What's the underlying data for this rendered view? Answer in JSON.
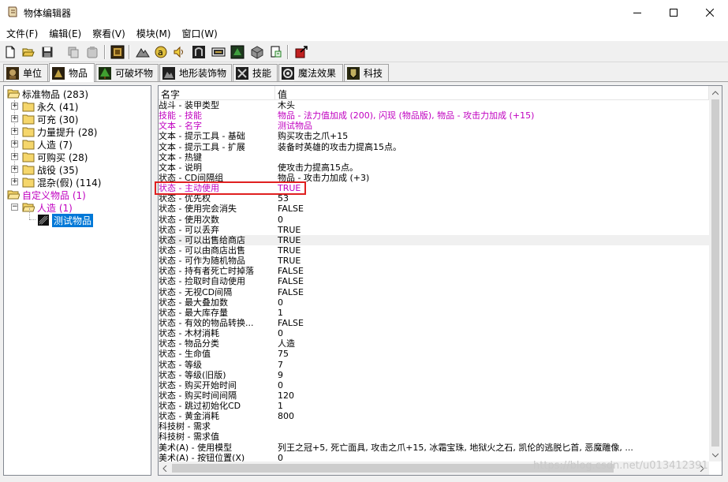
{
  "window": {
    "title": "物体编辑器",
    "icons": {
      "app": "scroll-icon",
      "minimize": "minimize-icon",
      "maximize": "maximize-icon",
      "close": "close-icon"
    }
  },
  "menu": [
    "文件(F)",
    "编辑(E)",
    "察看(V)",
    "模块(M)",
    "窗口(W)"
  ],
  "toolbar": [
    "new-file-icon",
    "open-folder-icon",
    "save-icon",
    "copy-icon",
    "paste-icon",
    "unit-editor-icon",
    "terrain-icon",
    "sound-icon",
    "volume-icon",
    "object-icon",
    "doodad-icon",
    "item-icon",
    "ability-icon",
    "upgrade-icon",
    "import-icon",
    "test-map-icon"
  ],
  "tabs": [
    {
      "label": "单位",
      "icon": "unit-tab-icon"
    },
    {
      "label": "物品",
      "icon": "item-tab-icon"
    },
    {
      "label": "可破坏物",
      "icon": "destructible-tab-icon"
    },
    {
      "label": "地形装饰物",
      "icon": "doodad-tab-icon"
    },
    {
      "label": "技能",
      "icon": "ability-tab-icon"
    },
    {
      "label": "魔法效果",
      "icon": "buff-tab-icon"
    },
    {
      "label": "科技",
      "icon": "upgrade-tab-icon"
    }
  ],
  "tree": {
    "standard": {
      "label": "标准物品 (283)",
      "children": [
        "永久 (41)",
        "可充 (30)",
        "力量提升 (28)",
        "人造 (7)",
        "可购买 (28)",
        "战役 (35)",
        "混杂(假) (114)"
      ]
    },
    "custom": {
      "label": "自定义物品 (1)",
      "child": "人造 (1)",
      "leaf": "测试物品"
    }
  },
  "list": {
    "columns": [
      "名字",
      "值"
    ],
    "rows": [
      {
        "name": "战斗 - 装甲类型",
        "value": "木头"
      },
      {
        "name": "技能 - 技能",
        "value": "物品 - 法力值加成 (200), 闪现 (物品版), 物品 - 攻击力加成 (+15)",
        "pink": true
      },
      {
        "name": "文本 - 名字",
        "value": "测试物品",
        "pink": true
      },
      {
        "name": "文本 - 提示工具 - 基础",
        "value": "购买攻击之爪+15"
      },
      {
        "name": "文本 - 提示工具 - 扩展",
        "value": "装备时英雄的攻击力提高15点。"
      },
      {
        "name": "文本 - 热键",
        "value": ""
      },
      {
        "name": "文本 - 说明",
        "value": "使攻击力提高15点。"
      },
      {
        "name": "状态 - CD间隔组",
        "value": "物品 - 攻击力加成 (+3)"
      },
      {
        "name": "状态 - 主动使用",
        "value": "TRUE",
        "pink": true
      },
      {
        "name": "状态 - 优先权",
        "value": "53"
      },
      {
        "name": "状态 - 使用完会消失",
        "value": "FALSE"
      },
      {
        "name": "状态 - 使用次数",
        "value": "0"
      },
      {
        "name": "状态 - 可以丢弃",
        "value": "TRUE"
      },
      {
        "name": "状态 - 可以出售给商店",
        "value": "TRUE",
        "hl": true
      },
      {
        "name": "状态 - 可以由商店出售",
        "value": "TRUE"
      },
      {
        "name": "状态 - 可作为随机物品",
        "value": "TRUE"
      },
      {
        "name": "状态 - 持有者死亡时掉落",
        "value": "FALSE"
      },
      {
        "name": "状态 - 捡取时自动使用",
        "value": "FALSE"
      },
      {
        "name": "状态 - 无视CD间隔",
        "value": "FALSE"
      },
      {
        "name": "状态 - 最大叠加数",
        "value": "0"
      },
      {
        "name": "状态 - 最大库存量",
        "value": "1"
      },
      {
        "name": "状态 - 有效的物品转换...",
        "value": "FALSE"
      },
      {
        "name": "状态 - 木材消耗",
        "value": "0"
      },
      {
        "name": "状态 - 物品分类",
        "value": "人造"
      },
      {
        "name": "状态 - 生命值",
        "value": "75"
      },
      {
        "name": "状态 - 等级",
        "value": "7"
      },
      {
        "name": "状态 - 等级(旧版)",
        "value": "9"
      },
      {
        "name": "状态 - 购买开始时间",
        "value": "0"
      },
      {
        "name": "状态 - 购买时间间隔",
        "value": "120"
      },
      {
        "name": "状态 - 跳过初始化CD",
        "value": "1"
      },
      {
        "name": "状态 - 黄金消耗",
        "value": "800"
      },
      {
        "name": "科技树 - 需求",
        "value": ""
      },
      {
        "name": "科技树 - 需求值",
        "value": ""
      },
      {
        "name": "美术(A) - 使用模型",
        "value": "列王之冠+5, 死亡面具, 攻击之爪+15, 冰霜宝珠, 地狱火之石, 凯伦的逃脱匕首, 恶魔雕像, ..."
      },
      {
        "name": "美术(A) - 按钮位置(X)",
        "value": "0"
      }
    ]
  },
  "watermark": "https://blog.csdn.net/u013412391"
}
